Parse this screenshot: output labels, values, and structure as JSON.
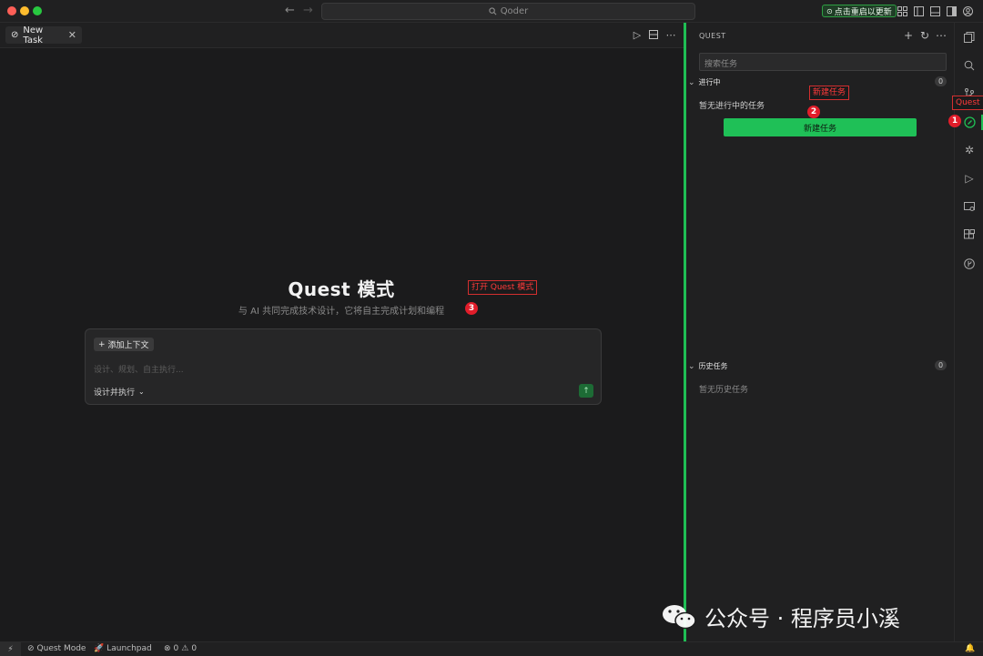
{
  "titlebar": {
    "app_title": "Qoder",
    "update_label": "点击重启以更新"
  },
  "editor": {
    "tab_label": "New Task",
    "quest_title": "Quest 模式",
    "quest_subtitle": "与 AI 共同完成技术设计，它将自主完成计划和编程",
    "add_context_label": "添加上下文",
    "input_placeholder": "设计、规划、自主执行...",
    "mode_label": "设计并执行"
  },
  "panel": {
    "title": "QUEST",
    "search_placeholder": "搜索任务",
    "in_progress": {
      "label": "进行中",
      "count": "0",
      "empty_text": "暂无进行中的任务",
      "new_task_label": "新建任务"
    },
    "history": {
      "label": "历史任务",
      "count": "0",
      "empty_text": "暂无历史任务"
    }
  },
  "annotations": {
    "callout_1": "Quest",
    "callout_2": "新建任务",
    "callout_3": "打开 Quest 模式",
    "badge_1": "1",
    "badge_2": "2",
    "badge_3": "3"
  },
  "statusbar": {
    "quest_mode": "Quest Mode",
    "launchpad": "Launchpad",
    "errors": "0",
    "warnings": "0"
  },
  "watermark": {
    "text": "公众号 · 程序员小溪"
  },
  "colors": {
    "accent_green": "#1fbe54",
    "annotation_red": "#e11d2a",
    "background": "#1b1b1c"
  }
}
